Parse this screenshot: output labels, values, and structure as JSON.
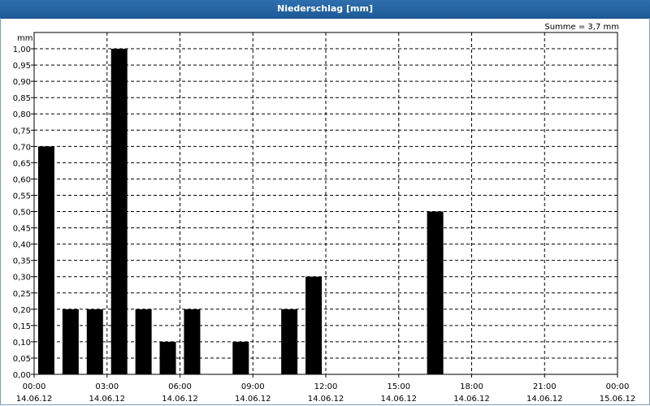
{
  "window": {
    "title": "Niederschlag [mm]"
  },
  "colors": {
    "titlebar": "#1d5a96",
    "bar": "#000000",
    "grid": "#000000"
  },
  "chart_data": {
    "type": "bar",
    "title": "Niederschlag [mm]",
    "ylabel": "mm",
    "annotation": "Summe = 3,7 mm",
    "ylim": [
      0,
      1.05
    ],
    "yticks": [
      "0,00",
      "0,05",
      "0,10",
      "0,15",
      "0,20",
      "0,25",
      "0,30",
      "0,35",
      "0,40",
      "0,45",
      "0,50",
      "0,55",
      "0,60",
      "0,65",
      "0,70",
      "0,75",
      "0,80",
      "0,85",
      "0,90",
      "0,95",
      "1,00"
    ],
    "xticks": [
      {
        "time": "00:00",
        "date": "14.06.12"
      },
      {
        "time": "03:00",
        "date": "14.06.12"
      },
      {
        "time": "06:00",
        "date": "14.06.12"
      },
      {
        "time": "09:00",
        "date": "14.06.12"
      },
      {
        "time": "12:00",
        "date": "14.06.12"
      },
      {
        "time": "15:00",
        "date": "14.06.12"
      },
      {
        "time": "18:00",
        "date": "14.06.12"
      },
      {
        "time": "21:00",
        "date": "14.06.12"
      },
      {
        "time": "00:00",
        "date": "15.06.12"
      }
    ],
    "x_hours": [
      0,
      1,
      2,
      3,
      4,
      5,
      6,
      8,
      10,
      11,
      16
    ],
    "values": [
      0.7,
      0.2,
      0.2,
      1.0,
      0.2,
      0.1,
      0.2,
      0.1,
      0.2,
      0.3,
      0.5
    ],
    "grid": true,
    "xrange_hours": [
      0,
      24
    ]
  }
}
